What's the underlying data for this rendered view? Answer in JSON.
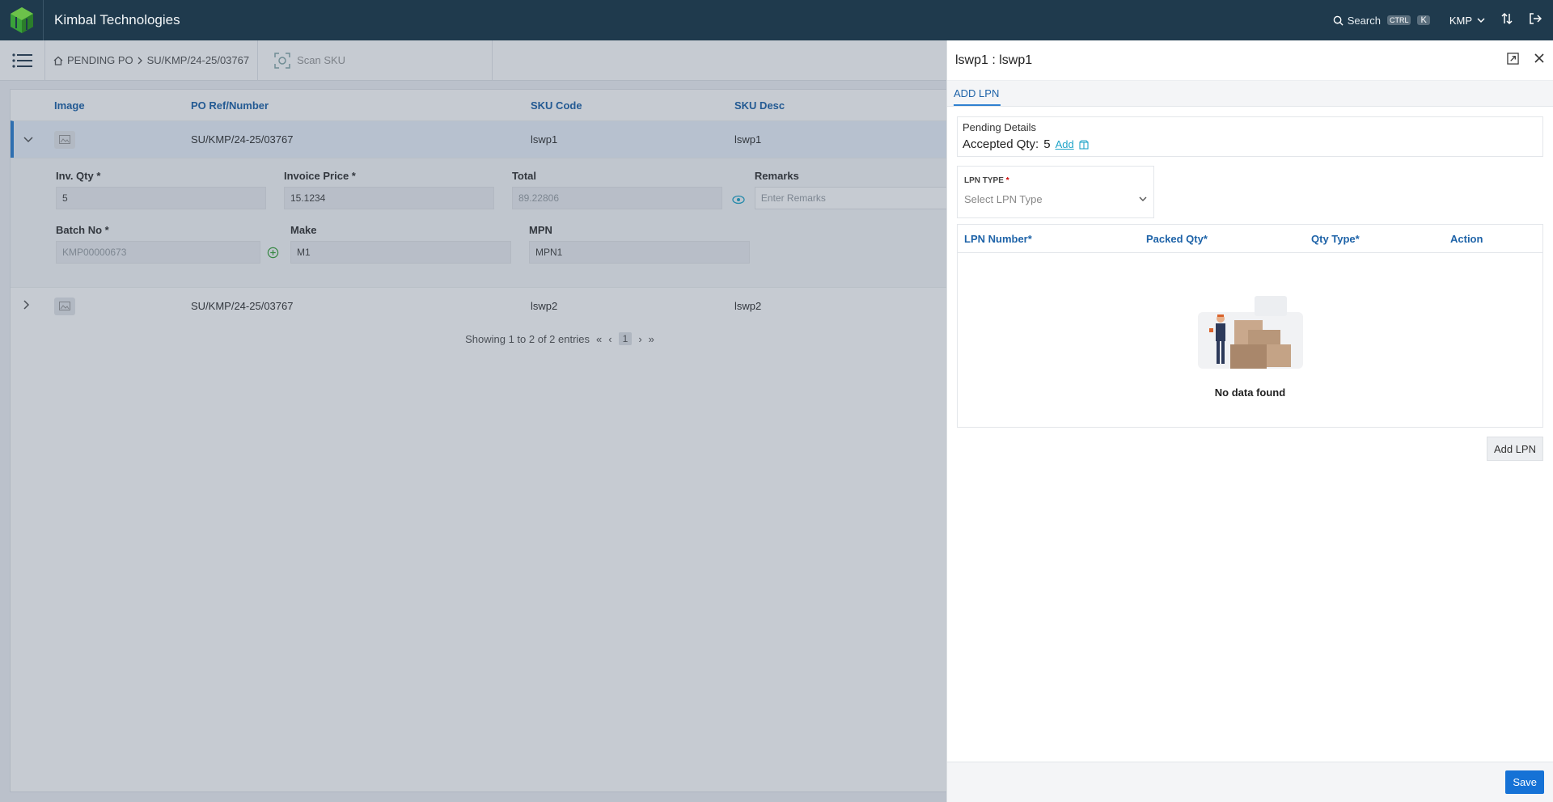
{
  "app": {
    "brand": "Kimbal Technologies"
  },
  "topbar": {
    "search_label": "Search",
    "kbd_ctrl": "CTRL",
    "kbd_k": "K",
    "org": "KMP"
  },
  "breadcrumb": {
    "home": "PENDING PO",
    "current": "SU/KMP/24-25/03767"
  },
  "scan": {
    "label": "Scan SKU"
  },
  "table": {
    "headers": {
      "image": "Image",
      "po": "PO Ref/Number",
      "sku": "SKU Code",
      "desc": "SKU Desc"
    },
    "rows": [
      {
        "po": "SU/KMP/24-25/03767",
        "sku": "lswp1",
        "desc": "lswp1"
      },
      {
        "po": "SU/KMP/24-25/03767",
        "sku": "lswp2",
        "desc": "lswp2"
      }
    ]
  },
  "detail": {
    "inv_qty_label": "Inv. Qty *",
    "inv_qty": "5",
    "price_label": "Invoice Price *",
    "price": "15.1234",
    "total_label": "Total",
    "total": "89.22806",
    "remarks_label": "Remarks",
    "remarks_placeholder": "Enter Remarks",
    "batch_label": "Batch No *",
    "batch": "KMP00000673",
    "make_label": "Make",
    "make": "M1",
    "mpn_label": "MPN",
    "mpn": "MPN1"
  },
  "pager": {
    "text": "Showing 1 to 2 of 2 entries",
    "page": "1"
  },
  "panel": {
    "title": "lswp1 : lswp1",
    "tab": "ADD LPN",
    "pending_title": "Pending Details",
    "accepted_label": "Accepted Qty:",
    "accepted_value": "5",
    "add_link": "Add",
    "lpn_type_label": "LPN TYPE",
    "lpn_type_required": "*",
    "lpn_type_placeholder": "Select LPN Type",
    "cols": {
      "lpn": "LPN Number*",
      "packed": "Packed Qty*",
      "qty_type": "Qty Type*",
      "action": "Action"
    },
    "empty": "No data found",
    "add_lpn_button": "Add LPN",
    "save_button": "Save"
  },
  "colors": {
    "topbar": "#1f3a4d",
    "accent": "#2f80d0",
    "save": "#1572d6"
  }
}
